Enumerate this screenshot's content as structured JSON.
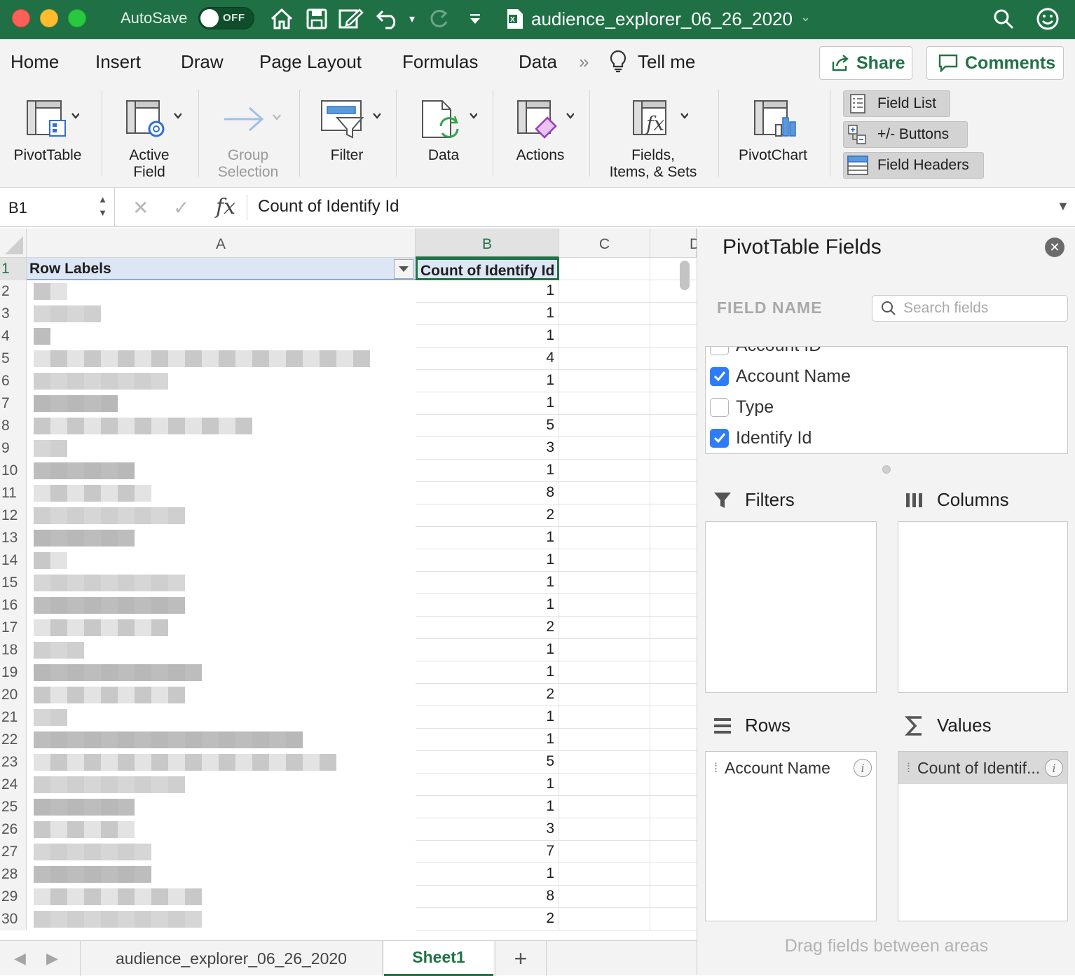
{
  "titlebar": {
    "autosave_label": "AutoSave",
    "autosave_state": "OFF",
    "document_title": "audience_explorer_06_26_2020",
    "icons": [
      "home-icon",
      "save-icon",
      "edit-icon",
      "undo-icon",
      "redo-icon",
      "customize-icon",
      "excel-file-icon",
      "search-icon",
      "smiley-icon"
    ]
  },
  "tabs": {
    "items": [
      "Home",
      "Insert",
      "Draw",
      "Page Layout",
      "Formulas",
      "Data"
    ],
    "overflow": "»",
    "tell_me": "Tell me",
    "share": "Share",
    "comments": "Comments"
  },
  "ribbon": {
    "pivottable": "PivotTable",
    "active_field_1": "Active",
    "active_field_2": "Field",
    "group_1": "Group",
    "group_2": "Selection",
    "filter": "Filter",
    "data": "Data",
    "actions": "Actions",
    "fields_1": "Fields,",
    "fields_2": "Items, & Sets",
    "pivotchart": "PivotChart",
    "field_list": "Field List",
    "buttons": "+/- Buttons",
    "field_headers": "Field Headers"
  },
  "formula": {
    "cell_ref": "B1",
    "value": "Count of Identify Id"
  },
  "grid": {
    "columns": [
      "A",
      "B",
      "C",
      "D"
    ],
    "header_a": "Row Labels",
    "header_b": "Count of Identify Id",
    "row_numbers": [
      "1",
      "2",
      "3",
      "4",
      "5",
      "6",
      "7",
      "8",
      "9",
      "10",
      "11",
      "12",
      "13",
      "14",
      "15",
      "16",
      "17",
      "18",
      "19",
      "20",
      "21",
      "22",
      "23",
      "24",
      "25",
      "26",
      "27",
      "28",
      "29",
      "30"
    ],
    "counts": [
      "1",
      "1",
      "1",
      "4",
      "1",
      "1",
      "5",
      "3",
      "1",
      "8",
      "2",
      "1",
      "1",
      "1",
      "1",
      "2",
      "1",
      "1",
      "2",
      "1",
      "1",
      "5",
      "1",
      "1",
      "3",
      "7",
      "1",
      "8",
      "2"
    ]
  },
  "sheets": {
    "tabs": [
      "audience_explorer_06_26_2020",
      "Sheet1"
    ],
    "active": "Sheet1",
    "add": "+"
  },
  "panel": {
    "title": "PivotTable Fields",
    "field_name": "FIELD NAME",
    "search_placeholder": "Search fields",
    "fields": [
      {
        "label": "Account ID",
        "checked": false
      },
      {
        "label": "Account Name",
        "checked": true
      },
      {
        "label": "Type",
        "checked": false
      },
      {
        "label": "Identify Id",
        "checked": true
      }
    ],
    "filters": "Filters",
    "columns": "Columns",
    "rows": "Rows",
    "values": "Values",
    "rows_item": "Account Name",
    "values_item": "Count of Identif...",
    "hint": "Drag fields between areas"
  },
  "colors": {
    "accent": "#217346",
    "titlebar": "#1f7145",
    "checkbox": "#2f7df6",
    "header_fill": "#dce6f4"
  }
}
